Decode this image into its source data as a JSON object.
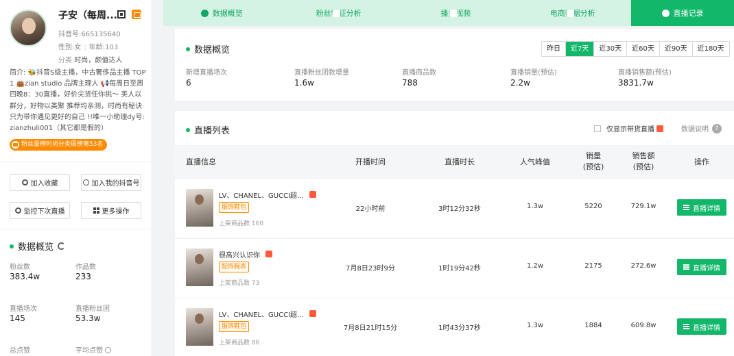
{
  "profile": {
    "name": "子安（每周...",
    "douyin_id": "抖音号:665135640",
    "gender": "性别:女",
    "age": "年龄:103",
    "category_label": "分类:",
    "category_value": "时尚，颜值达人",
    "bio": "简介: 🐝抖音S级主播，中古奢侈品主播 TOP1 👜zian studio 品牌主理人 📢每周日至周四晚8：30直播，好价尖货任你挑～ 美人以群分，好物以类聚 推荐均亲测，时尚有秘诀 只为带你遇见更好的自己 !!唯一小助理dy号: zianzhuli001（其它都是假的）",
    "rank_badge": "粉丝量榜时尚分类周榜第53名"
  },
  "actions": {
    "favorite": "加入收藏",
    "add_douyin": "加入我的抖音号",
    "monitor": "监控下次直播",
    "more": "更多操作"
  },
  "side_overview": {
    "title": "数据概览",
    "stats": [
      {
        "label": "粉丝数",
        "value": "383.4w"
      },
      {
        "label": "作品数",
        "value": "233"
      },
      {
        "label": "直播场次",
        "value": "145"
      },
      {
        "label": "直播粉丝团",
        "value": "53.3w"
      },
      {
        "label": "总点赞",
        "value": ""
      },
      {
        "label": "平均点赞",
        "value": ""
      }
    ]
  },
  "tabs": [
    {
      "label": "数据概览",
      "icon": "pie-chart-icon"
    },
    {
      "label": "粉丝特征分析",
      "icon": "id-card-icon"
    },
    {
      "label": "播主视频",
      "icon": "video-icon"
    },
    {
      "label": "电商数据分析",
      "icon": "shop-icon"
    },
    {
      "label": "直播记录",
      "icon": "clock-icon",
      "active": true
    }
  ],
  "overview": {
    "title": "数据概览",
    "periods": [
      "昨日",
      "近7天",
      "近30天",
      "近60天",
      "近90天",
      "近180天"
    ],
    "active_period": "近7天",
    "metrics": [
      {
        "label": "新增直播场次",
        "value": "6"
      },
      {
        "label": "直播粉丝团数增量",
        "value": "1.6w"
      },
      {
        "label": "直播商品数",
        "value": "788"
      },
      {
        "label": "直播销量(预估)",
        "value": "2.2w"
      },
      {
        "label": "直播销售额(预估)",
        "value": "3831.7w"
      }
    ]
  },
  "live_list": {
    "title": "直播列表",
    "filter_label": "仅显示带货直播",
    "help_label": "数据说明",
    "help_mark": "?",
    "columns": {
      "info": "直播信息",
      "start": "开播时间",
      "duration": "直播时长",
      "peak": "人气峰值",
      "sales_1": "销量",
      "sales_2": "(预估)",
      "gmv_1": "销售额",
      "gmv_2": "(预估)",
      "op": "操作"
    },
    "detail_label": "直播详情",
    "rows": [
      {
        "title": "LV、CHANEL、GUCCI超...",
        "tag": "服饰鞋包",
        "count": "上架商品数 160",
        "start": "22小时前",
        "duration": "3时12分32秒",
        "peak": "1.3w",
        "sales": "5220",
        "gmv": "729.1w"
      },
      {
        "title": "很高兴认识你",
        "tag": "配饰腕表",
        "count": "上架商品数 73",
        "start": "7月8日23时9分",
        "duration": "1时19分42秒",
        "peak": "1.2w",
        "sales": "2175",
        "gmv": "272.6w"
      },
      {
        "title": "LV、CHANEL、GUCCI超...",
        "tag": "服饰鞋包",
        "count": "上架商品数 86",
        "start": "7月8日21时15分",
        "duration": "1时43分37秒",
        "peak": "1.3w",
        "sales": "1884",
        "gmv": "609.8w"
      }
    ]
  },
  "colors": {
    "accent": "#12b76a",
    "tab_bg": "#d4f3e4",
    "orange": "#ff8a00"
  }
}
